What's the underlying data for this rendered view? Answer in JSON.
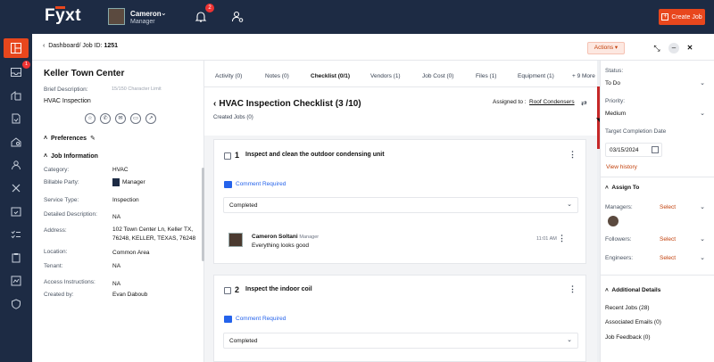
{
  "header": {
    "logo": "Fyxt",
    "user_name": "Cameron",
    "user_role": "Manager",
    "notif_count": "2",
    "create_job": "Create Job"
  },
  "nav": {
    "inbox_badge": "1"
  },
  "breadcrumb": {
    "path": "Dashboard/ Job ID:",
    "job_id": "1251",
    "actions": "Actions ▾"
  },
  "job": {
    "title": "Keller Town Center",
    "brief_label": "Brief Description:",
    "brief_limit": "15/150 Character Limit",
    "brief_value": "HVAC Inspection",
    "preferences": "Preferences",
    "job_info": "Job Information",
    "fields": [
      {
        "label": "Category:",
        "value": "HVAC"
      },
      {
        "label": "Billable Party:",
        "value": "Manager"
      },
      {
        "label": "Service Type:",
        "value": "Inspection"
      },
      {
        "label": "Detailed Description:",
        "value": "NA"
      },
      {
        "label": "Address:",
        "value": "102 Town Center Ln, Keller TX, 76248, KELLER, TEXAS, 76248"
      },
      {
        "label": "Location:",
        "value": "Common Area"
      },
      {
        "label": "Tenant:",
        "value": "NA"
      },
      {
        "label": "Access Instructions:",
        "value": "NA"
      },
      {
        "label": "Created by:",
        "value": "Evan Daboub"
      }
    ]
  },
  "tabs": [
    "Activity (0)",
    "Notes (0)",
    "Checklist (0/1)",
    "Vendors (1)",
    "Job Cost (0)",
    "Files (1)",
    "Equipment (1)",
    "+ 9 More"
  ],
  "checklist": {
    "title": "HVAC Inspection Checklist (3 /10)",
    "assigned_label": "Assigned to :",
    "assigned_to": "Roof Condensers",
    "created_jobs": "Created Jobs (0)",
    "items": [
      {
        "num": "1",
        "text": "Inspect and clean the outdoor condensing unit",
        "comment_req": "Comment Required",
        "status": "Completed",
        "comment": {
          "author": "Cameron Soltani",
          "role": "Manager",
          "text": "Everything looks good",
          "time": "11:01 AM"
        }
      },
      {
        "num": "2",
        "text": "Inspect the indoor coil",
        "comment_req": "Comment Required",
        "status": "Completed"
      }
    ]
  },
  "sidebar": {
    "status_label": "Status:",
    "status_value": "To Do",
    "priority_label": "Priority:",
    "priority_value": "Medium",
    "target_label": "Target Completion Date",
    "target_value": "03/15/2024",
    "view_history": "View history",
    "assign_to": "Assign To",
    "managers": "Managers:",
    "followers": "Followers:",
    "engineers": "Engineers:",
    "select": "Select",
    "additional": "Additional Details",
    "recent_jobs": "Recent Jobs (28)",
    "assoc_emails": "Associated Emails (0)",
    "job_feedback": "Job Feedback (0)"
  },
  "colors": {
    "accent": "#e8471d",
    "nav_bg": "#1d2b44",
    "link": "#2563eb"
  }
}
